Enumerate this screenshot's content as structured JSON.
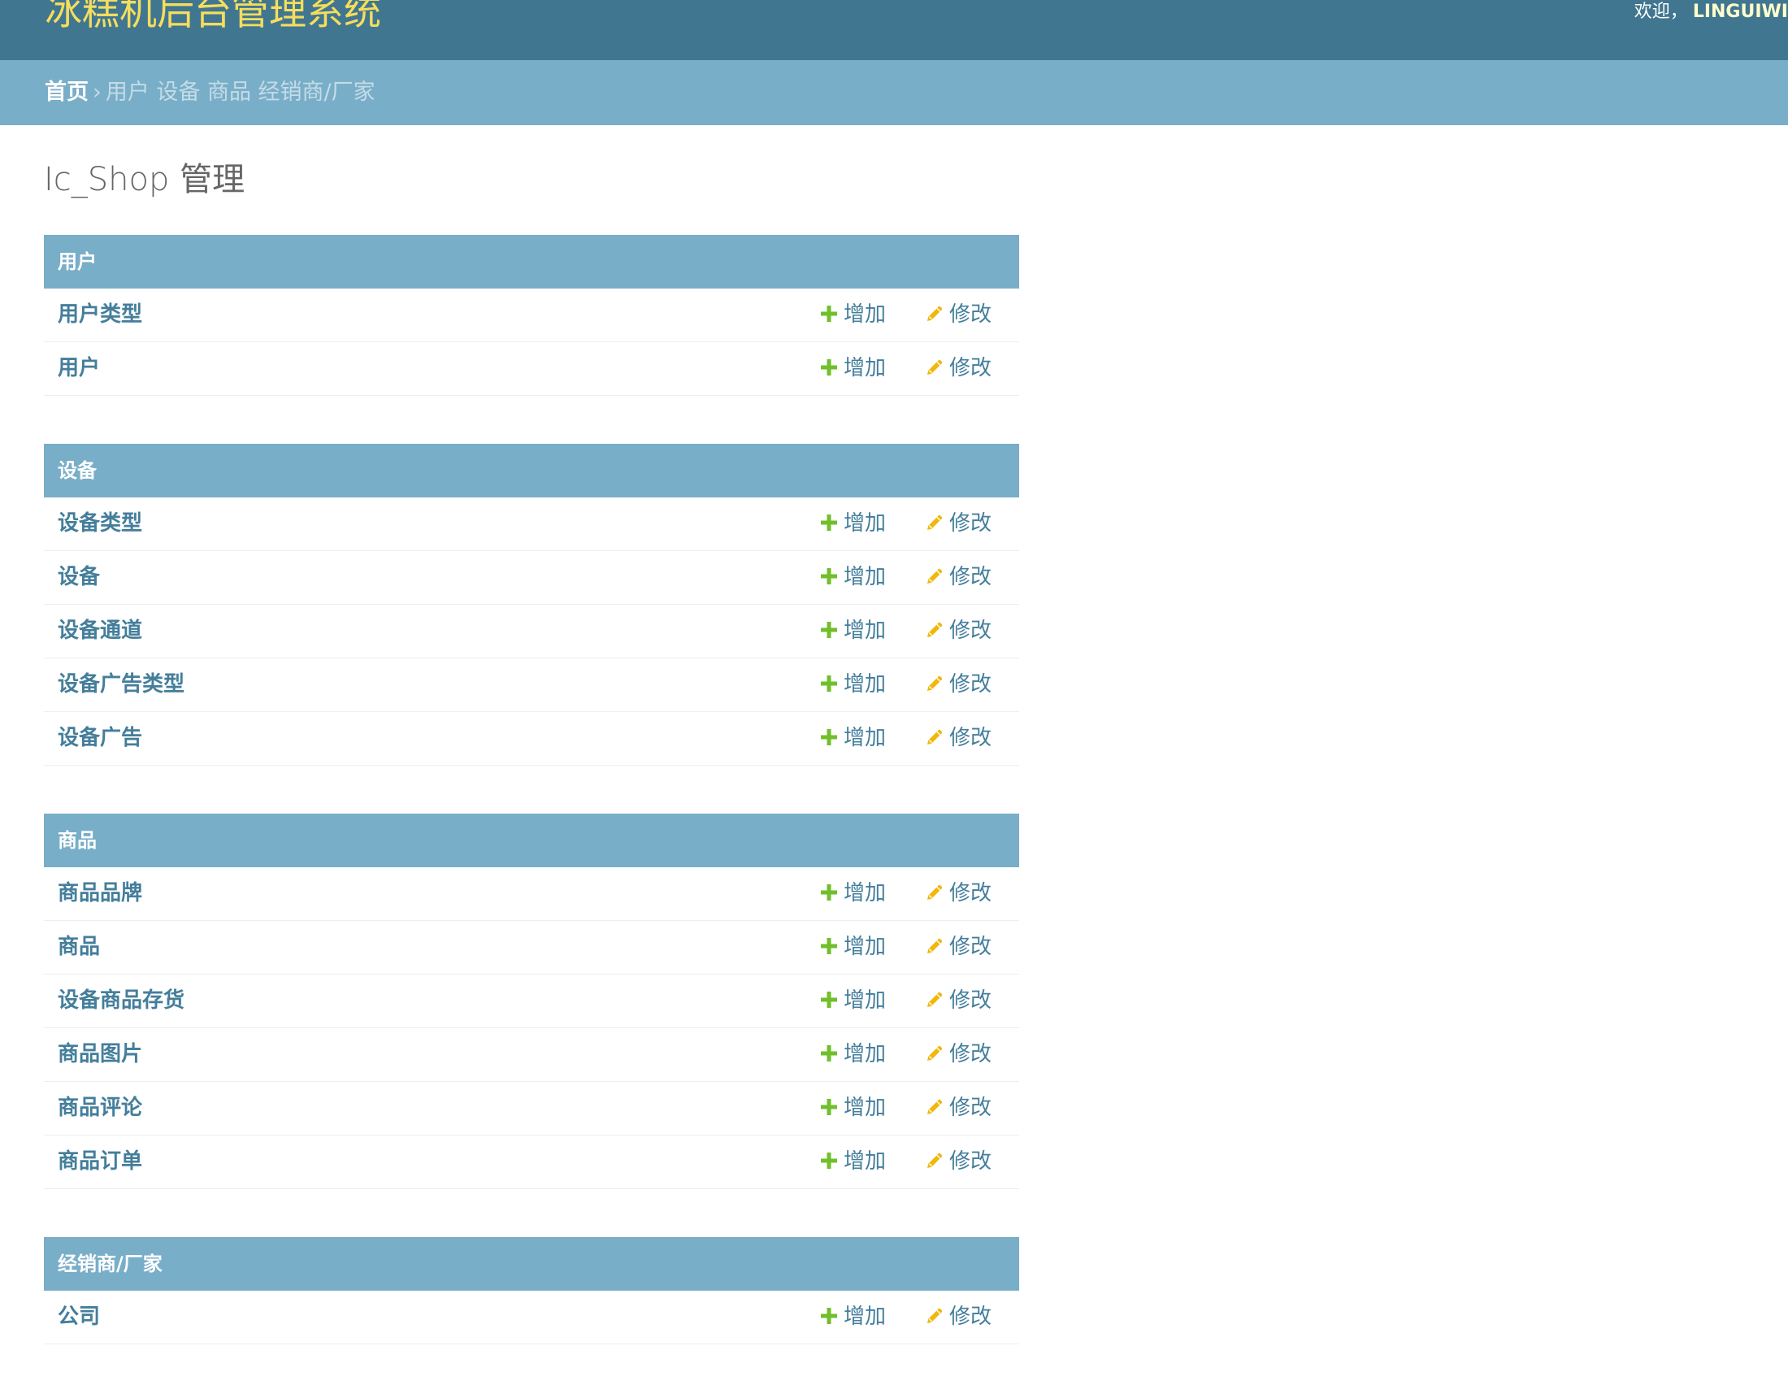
{
  "header": {
    "site_name": "冰糕机后台管理系统",
    "welcome": "欢迎，",
    "user_name": "LINGUIWI"
  },
  "breadcrumbs": {
    "home": "首页",
    "separator": "›",
    "rest": "用户 设备 商品 经销商/厂家"
  },
  "page_title": "Ic_Shop 管理",
  "colors": {
    "header_bg": "#417690",
    "breadcrumb_bg": "#79aec8",
    "site_name": "#f5dd5d",
    "link": "#447e9b",
    "add_icon": "#70bf2b",
    "change_icon": "#efb80b"
  },
  "actions": {
    "add_label": "增加",
    "change_label": "修改",
    "add_icon": "plus-icon",
    "change_icon": "pencil-icon"
  },
  "modules": [
    {
      "caption": "用户",
      "models": [
        {
          "name": "用户类型"
        },
        {
          "name": "用户"
        }
      ]
    },
    {
      "caption": "设备",
      "models": [
        {
          "name": "设备类型"
        },
        {
          "name": "设备"
        },
        {
          "name": "设备通道"
        },
        {
          "name": "设备广告类型"
        },
        {
          "name": "设备广告"
        }
      ]
    },
    {
      "caption": "商品",
      "models": [
        {
          "name": "商品品牌"
        },
        {
          "name": "商品"
        },
        {
          "name": "设备商品存货"
        },
        {
          "name": "商品图片"
        },
        {
          "name": "商品评论"
        },
        {
          "name": "商品订单"
        }
      ]
    },
    {
      "caption": "经销商/厂家",
      "models": [
        {
          "name": "公司"
        }
      ]
    }
  ]
}
